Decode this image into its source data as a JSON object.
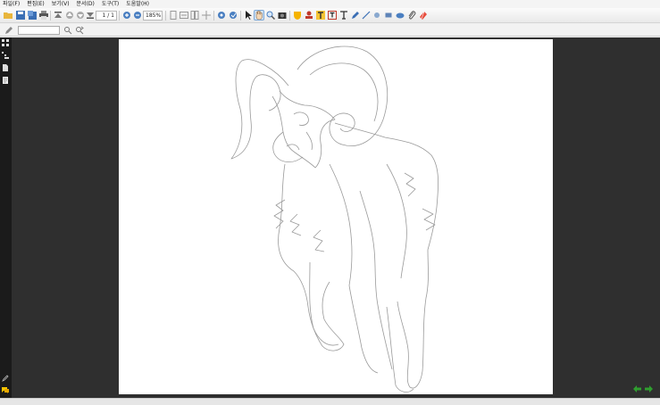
{
  "menu": [
    "파일(F)",
    "편집(E)",
    "보기(V)",
    "문서(D)",
    "도구(T)",
    "도움말(H)"
  ],
  "toolbar": {
    "page_current": "1",
    "page_separator": "/",
    "page_total": "1",
    "zoom_value": "185",
    "zoom_unit": "%"
  },
  "search": {
    "value": ""
  },
  "colors": {
    "sidebar_bg": "#1b1b1b",
    "doc_bg": "#2f2f2f",
    "page_bg": "#ffffff",
    "active_tool": "#cfe3f7",
    "nav_arrow": "#2f9e2f"
  }
}
